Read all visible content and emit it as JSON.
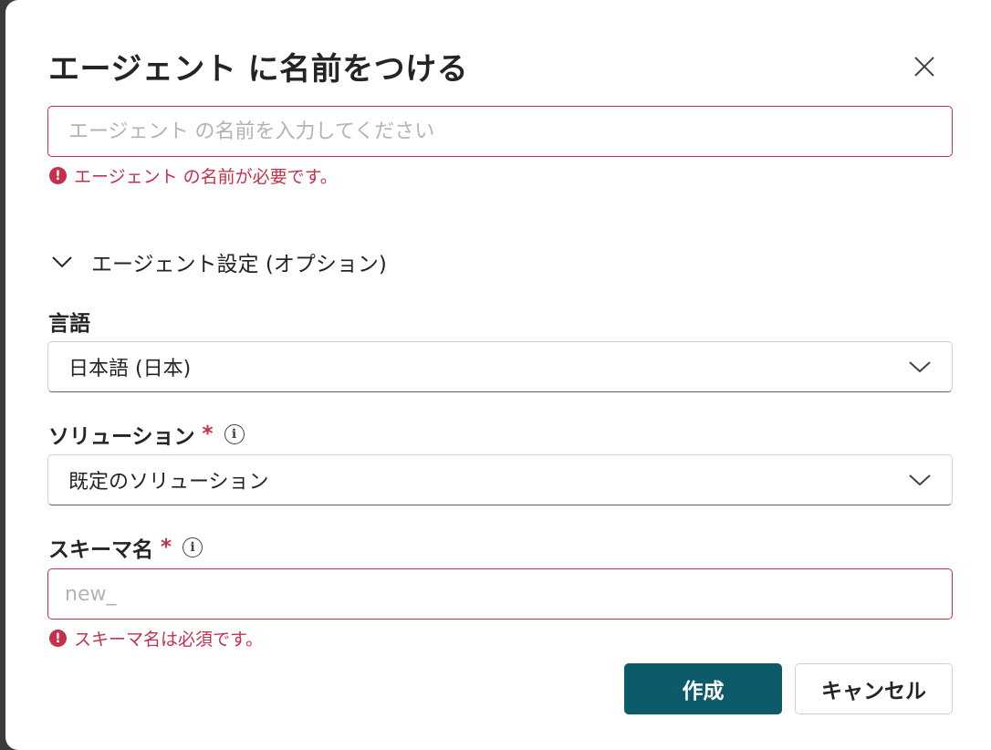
{
  "dialog": {
    "title": "エージェント に名前をつける",
    "close_icon": "close-icon"
  },
  "agent_name": {
    "value": "",
    "placeholder": "エージェント の名前を入力してください",
    "error": "エージェント の名前が必要です。"
  },
  "settings_section": {
    "label": "エージェント設定 (オプション)",
    "expanded": true
  },
  "language": {
    "label": "言語",
    "selected": "日本語 (日本)"
  },
  "solution": {
    "label": "ソリューション",
    "required_mark": "*",
    "selected": "既定のソリューション"
  },
  "schema_name": {
    "label": "スキーマ名",
    "required_mark": "*",
    "value": "",
    "placeholder": "new_",
    "error": "スキーマ名は必須です。"
  },
  "actions": {
    "create_label": "作成",
    "cancel_label": "キャンセル"
  },
  "colors": {
    "primary": "#0c5a6a",
    "error": "#c4314b"
  }
}
